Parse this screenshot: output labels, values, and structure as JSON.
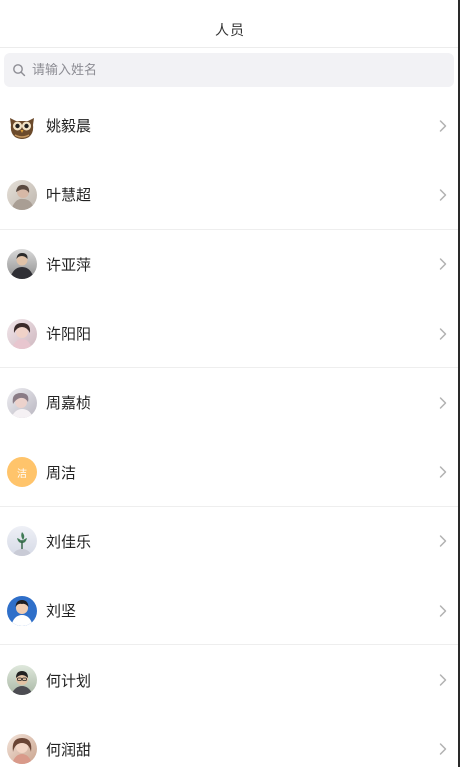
{
  "header": {
    "title": "人员"
  },
  "search": {
    "placeholder": "请输入姓名"
  },
  "people": [
    {
      "name": "姚毅晨",
      "avatar": "owl-avatar"
    },
    {
      "name": "叶慧超",
      "avatar": "photo-avatar"
    },
    {
      "name": "许亚萍",
      "avatar": "photo-avatar"
    },
    {
      "name": "许阳阳",
      "avatar": "photo-avatar"
    },
    {
      "name": "周嘉桢",
      "avatar": "photo-avatar"
    },
    {
      "name": "周洁",
      "avatar": "initial-avatar",
      "initial": "洁",
      "color": "#ffc46b"
    },
    {
      "name": "刘佳乐",
      "avatar": "photo-avatar"
    },
    {
      "name": "刘坚",
      "avatar": "photo-avatar"
    },
    {
      "name": "何计划",
      "avatar": "photo-avatar"
    },
    {
      "name": "何润甜",
      "avatar": "photo-avatar"
    }
  ]
}
